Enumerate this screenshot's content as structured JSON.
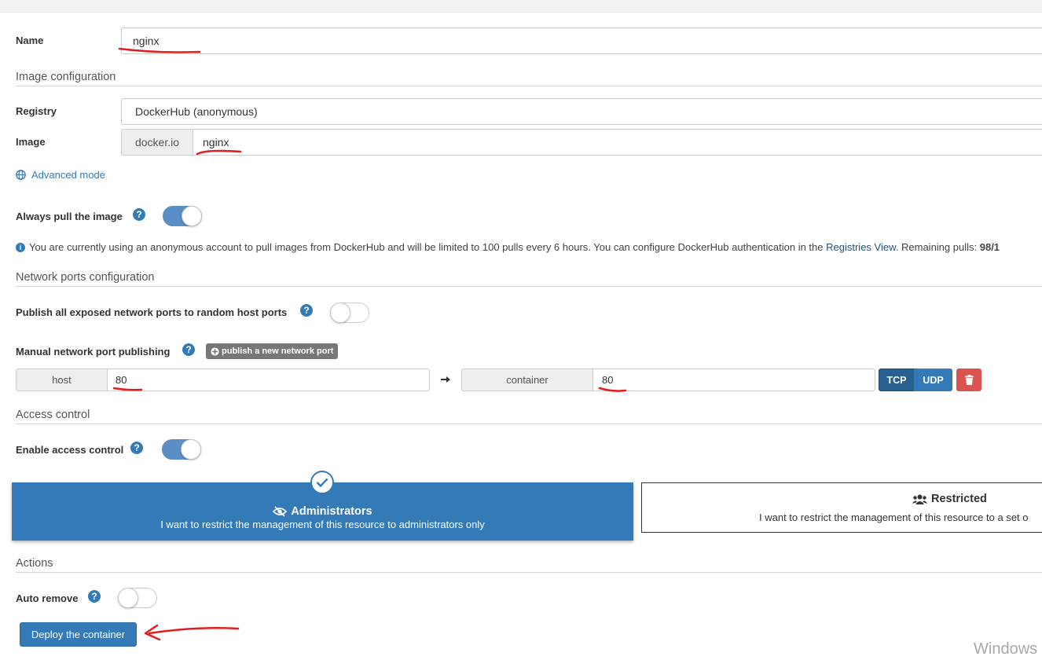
{
  "name": {
    "label": "Name",
    "value": "nginx"
  },
  "image_config": {
    "title": "Image configuration",
    "registry_label": "Registry",
    "registry_value": "DockerHub (anonymous)",
    "image_label": "Image",
    "image_prefix": "docker.io",
    "image_value": "nginx",
    "advanced_mode": "Advanced mode"
  },
  "always_pull": {
    "label": "Always pull the image",
    "enabled": true
  },
  "dockerhub_notice": {
    "text": "You are currently using an anonymous account to pull images from DockerHub and will be limited to 100 pulls every 6 hours. You can configure DockerHub authentication in the",
    "link": "Registries View.",
    "remaining_label": "Remaining pulls:",
    "remaining_value": "98/1"
  },
  "network": {
    "title": "Network ports configuration",
    "publish_all_label": "Publish all exposed network ports to random host ports",
    "publish_all_enabled": false,
    "manual_label": "Manual network port publishing",
    "publish_button": "publish a new network port",
    "port_row": {
      "host_label": "host",
      "host_value": "80",
      "container_label": "container",
      "container_value": "80",
      "protocols": [
        "TCP",
        "UDP"
      ],
      "active_protocol": "TCP"
    }
  },
  "access_control": {
    "title": "Access control",
    "enable_label": "Enable access control",
    "enabled": true,
    "admin_title": "Administrators",
    "admin_desc": "I want to restrict the management of this resource to administrators only",
    "restricted_title": "Restricted",
    "restricted_desc": "I want to restrict the management of this resource to a set o"
  },
  "actions": {
    "title": "Actions",
    "auto_remove_label": "Auto remove",
    "auto_remove_enabled": false,
    "deploy_button": "Deploy the container"
  },
  "os_watermark": "Windows",
  "colors": {
    "primary": "#337ab7",
    "primary_dark": "#286090",
    "danger": "#d9534f",
    "annotation": "#e31c1c"
  },
  "icons": [
    "globe-icon",
    "help-icon",
    "info-icon",
    "plus-circle-icon",
    "arrow-right-icon",
    "trash-icon",
    "check-circle-icon",
    "eye-slash-icon",
    "users-icon"
  ]
}
